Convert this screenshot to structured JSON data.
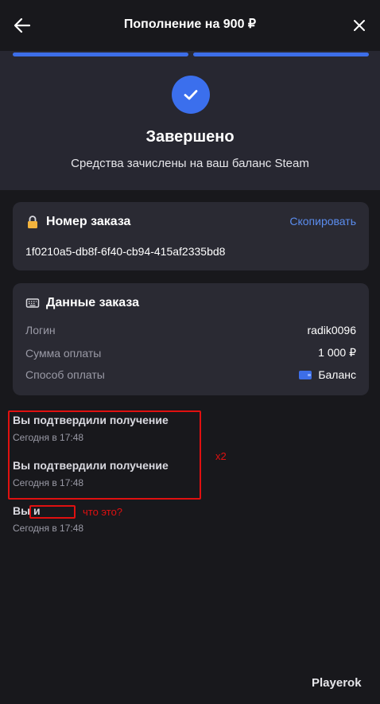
{
  "header": {
    "title": "Пополнение на 900 ₽",
    "back_icon": "arrow-left-icon",
    "close_icon": "close-icon"
  },
  "status": {
    "icon": "check-circle-icon",
    "title": "Завершено",
    "subtitle": "Средства зачислены на ваш баланс Steam"
  },
  "order_number": {
    "heading": "Номер заказа",
    "icon": "lock-icon",
    "copy_label": "Скопировать",
    "value": "1f0210a5-db8f-6f40-cb94-415af2335bd8"
  },
  "order_data": {
    "heading": "Данные заказа",
    "icon": "keyboard-icon",
    "rows": [
      {
        "label": "Логин",
        "value": "radik0096"
      },
      {
        "label": "Сумма оплаты",
        "value": "1 000 ₽"
      },
      {
        "label": "Способ оплаты",
        "value": "Баланс",
        "icon": "wallet-icon"
      }
    ]
  },
  "events": [
    {
      "title": "Вы подтвердили получение",
      "time": "Сегодня в 17:48"
    },
    {
      "title": "Вы подтвердили получение",
      "time": "Сегодня в 17:48"
    },
    {
      "title": "Вы и",
      "time": "Сегодня в 17:48"
    }
  ],
  "annotations": {
    "duplicate_note": "x2",
    "question_note": "что это?",
    "color": "#e01010"
  },
  "brand": "Playerok",
  "colors": {
    "accent": "#3b6fed",
    "link": "#5b8def",
    "background": "#18181c",
    "card": "#2a2a33"
  }
}
